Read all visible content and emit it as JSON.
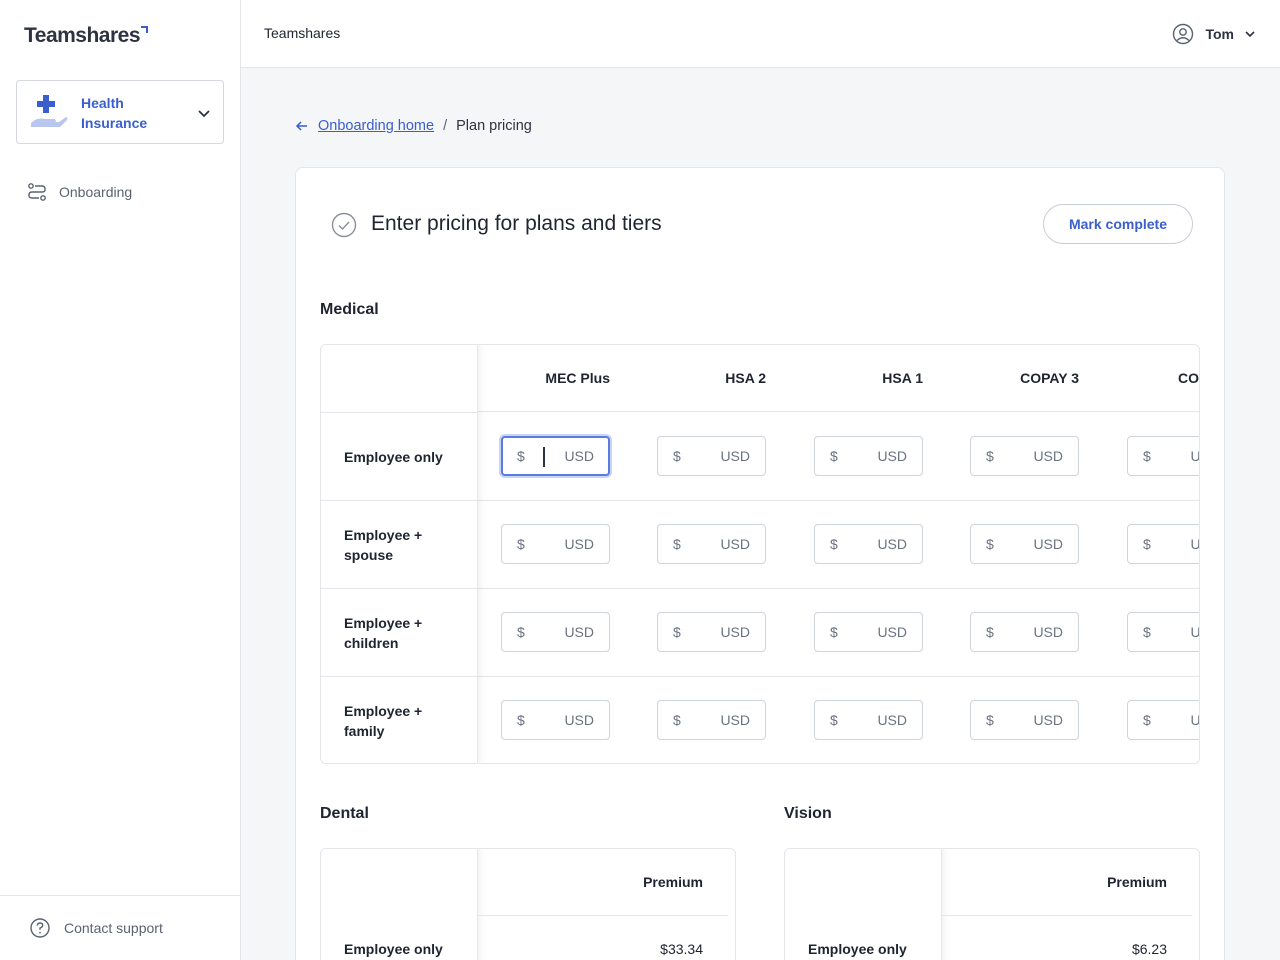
{
  "sidebar": {
    "logo": "Teamshares",
    "product": {
      "label": "Health Insurance",
      "icon": "health-hand-icon"
    },
    "nav": [
      {
        "label": "Onboarding",
        "icon": "onboarding-icon"
      }
    ],
    "footer": {
      "label": "Contact support",
      "icon": "help-circle-icon"
    }
  },
  "topbar": {
    "org": "Teamshares",
    "user": {
      "name": "Tom",
      "icon": "user-circle-icon"
    }
  },
  "breadcrumb": {
    "parent": "Onboarding home",
    "separator": "/",
    "current": "Plan pricing"
  },
  "card": {
    "title": "Enter pricing for plans and tiers",
    "mark_complete": "Mark complete"
  },
  "medical": {
    "heading": "Medical",
    "columns": [
      "MEC Plus",
      "HSA 2",
      "HSA 1",
      "COPAY 3",
      "CO"
    ],
    "rows": [
      "Employee only",
      "Employee + spouse",
      "Employee + children",
      "Employee + family"
    ],
    "currency_symbol": "$",
    "unit": "USD",
    "focused_cell": "Employee only / MEC Plus"
  },
  "dental": {
    "heading": "Dental",
    "column": "Premium",
    "rows": [
      {
        "label": "Employee only",
        "value": "$33.34"
      }
    ]
  },
  "vision": {
    "heading": "Vision",
    "column": "Premium",
    "rows": [
      {
        "label": "Employee only",
        "value": "$6.23"
      }
    ]
  },
  "colors": {
    "accent": "#3a5fcc",
    "border": "#e4e6ea",
    "focus": "#5a7be0"
  }
}
